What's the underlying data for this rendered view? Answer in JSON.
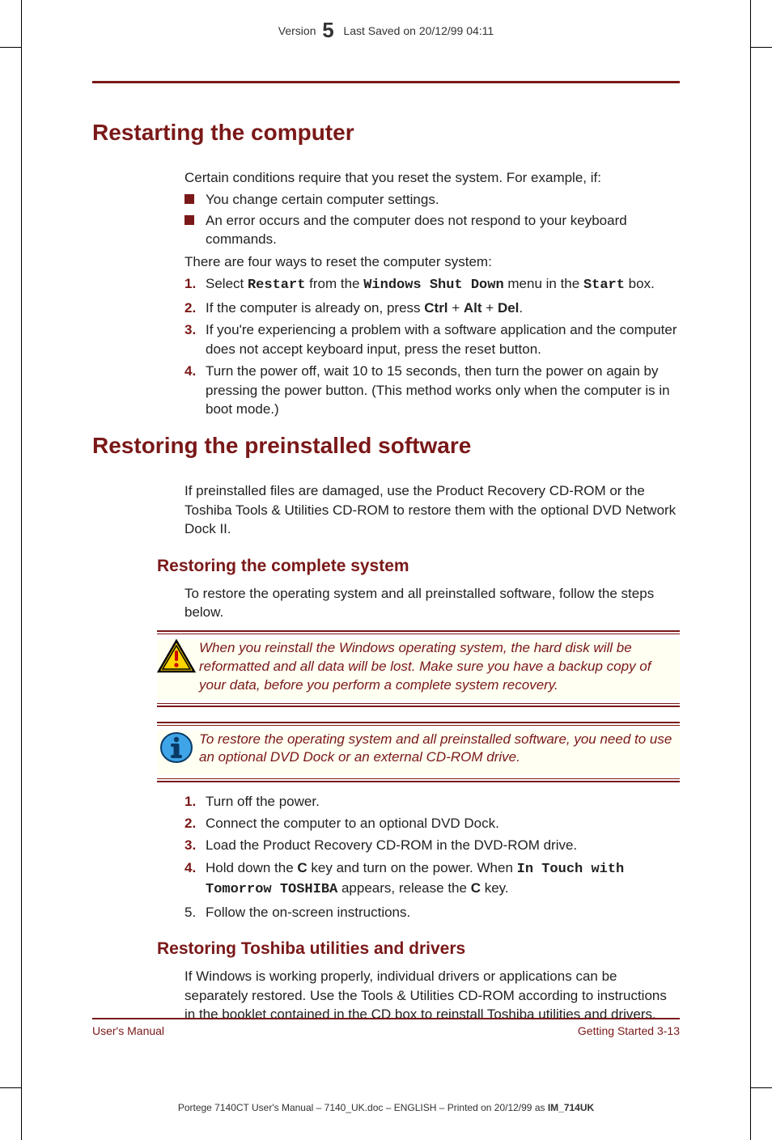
{
  "header": {
    "prefix": "Version",
    "big": "5",
    "suffix": "Last Saved on 20/12/99 04:11"
  },
  "s1": {
    "title": "Restarting the computer",
    "p1": "Certain conditions require that you reset the system. For example, if:",
    "b1": "You change certain computer settings.",
    "b2": "An error occurs and the computer does not respond to your keyboard commands.",
    "p2": "There are four ways to reset the computer system:",
    "o1a": "Select ",
    "o1b": "Restart",
    "o1c": " from the ",
    "o1d": "Windows Shut Down",
    "o1e": " menu in the ",
    "o1f": "Start",
    "o1g": " box.",
    "o2a": "If the computer is already on, press ",
    "o2b": "Ctrl",
    "o2c": " + ",
    "o2d": "Alt",
    "o2e": " + ",
    "o2f": "Del",
    "o2g": ".",
    "o3": "If you're experiencing a problem with a software application and the computer does not accept keyboard input, press the reset button.",
    "o4": "Turn the power off, wait 10 to 15 seconds, then turn the power on again by pressing the power button. (This method works only when the computer is in boot mode.)"
  },
  "s2": {
    "title": "Restoring the preinstalled software",
    "p1": "If preinstalled files are damaged, use the Product Recovery CD-ROM or the Toshiba Tools & Utilities CD-ROM to restore them with the optional DVD Network Dock II.",
    "h2a": "Restoring the complete system",
    "p2": "To restore the operating system and all preinstalled software, follow the steps below.",
    "warn": "When you reinstall the Windows operating system, the hard disk will be reformatted and all data will be lost. Make sure you have a backup copy of your data, before you perform a complete system recovery.",
    "info": "To restore the operating system and all preinstalled software, you need to use an optional DVD Dock or an external CD-ROM drive.",
    "o1": "Turn off the power.",
    "o2": "Connect the computer to an optional DVD Dock.",
    "o3": "Load the Product Recovery CD-ROM in the DVD-ROM drive.",
    "o4a": "Hold down the ",
    "o4b": "C",
    "o4c": " key and turn on the power. When ",
    "o4d": "In Touch with Tomorrow TOSHIBA",
    "o4e": " appears, release the ",
    "o4f": "C",
    "o4g": " key.",
    "o5": "Follow the on-screen instructions.",
    "h2b": "Restoring Toshiba utilities and drivers",
    "p3": "If Windows is working properly, individual drivers or applications can be separately restored. Use the Tools & Utilities CD-ROM according to instructions in the booklet contained in the CD box to reinstall Toshiba utilities and drivers."
  },
  "footer": {
    "left": "User's Manual",
    "right": "Getting Started  3-13"
  },
  "base": {
    "a": "Portege 7140CT User's Manual  – 7140_UK.doc – ENGLISH – Printed on 20/12/99 as ",
    "b": "IM_714UK"
  },
  "nums": {
    "n1": "1.",
    "n2": "2.",
    "n3": "3.",
    "n4": "4.",
    "n5": "5."
  }
}
